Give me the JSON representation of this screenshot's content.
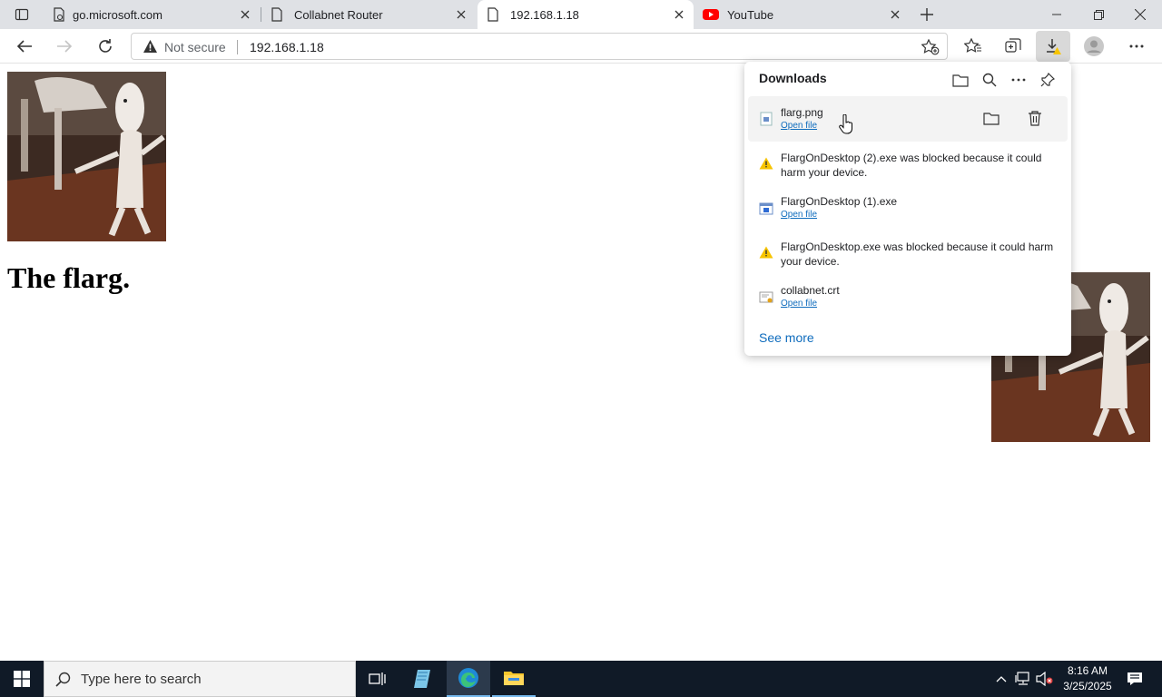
{
  "tabs": [
    {
      "title": "go.microsoft.com",
      "active": false
    },
    {
      "title": "Collabnet Router",
      "active": false
    },
    {
      "title": "192.168.1.18",
      "active": true
    },
    {
      "title": "YouTube",
      "active": false
    }
  ],
  "address": {
    "security_label": "Not secure",
    "url": "192.168.1.18"
  },
  "page": {
    "heading": "The flarg."
  },
  "downloads": {
    "title": "Downloads",
    "items": [
      {
        "name": "flarg.png",
        "action": "Open file",
        "status": "complete",
        "icon": "image-file-icon"
      },
      {
        "name": "FlargOnDesktop (2).exe was blocked because it could harm your device.",
        "status": "blocked",
        "icon": "warning-icon"
      },
      {
        "name": "FlargOnDesktop (1).exe",
        "action": "Open file",
        "status": "complete",
        "icon": "exe-file-icon"
      },
      {
        "name": "FlargOnDesktop.exe was blocked because it could harm your device.",
        "status": "blocked",
        "icon": "warning-icon"
      },
      {
        "name": "collabnet.crt",
        "action": "Open file",
        "status": "complete",
        "icon": "certificate-file-icon"
      }
    ],
    "see_more": "See more"
  },
  "taskbar": {
    "search_placeholder": "Type here to search",
    "time": "8:16 AM",
    "date": "3/25/2025"
  },
  "colors": {
    "link": "#0f6cbd",
    "warning": "#f7c400",
    "youtube_red": "#ff0000",
    "taskbar": "#101a27"
  }
}
